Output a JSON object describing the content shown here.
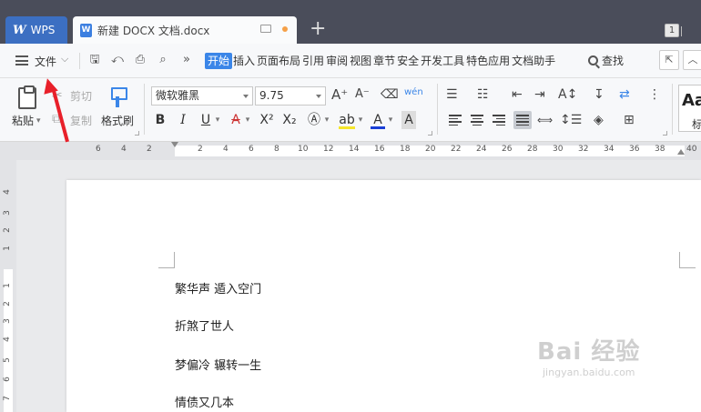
{
  "titlebar": {
    "app_tab": "WPS",
    "doc_tab": "新建 DOCX 文档.docx",
    "tab_count": "1"
  },
  "menubar": {
    "file_label": "文件",
    "tabs": [
      "开始",
      "插入",
      "页面布局",
      "引用",
      "审阅",
      "视图",
      "章节",
      "安全",
      "开发工具",
      "特色应用",
      "文档助手"
    ],
    "active_tab": "开始",
    "search_label": "查找"
  },
  "ribbon": {
    "paste_label": "粘贴",
    "cut_label": "剪切",
    "copy_label": "复制",
    "format_painter_label": "格式刷",
    "font_name": "微软雅黑",
    "font_size": "9.75",
    "style_label": "标"
  },
  "ruler": {
    "h_ticks": [
      "6",
      "4",
      "2",
      "2",
      "4",
      "6",
      "8",
      "10",
      "12",
      "14",
      "16",
      "18",
      "20",
      "22",
      "24",
      "26",
      "28",
      "30",
      "32",
      "34",
      "36",
      "38",
      "40"
    ],
    "v_ticks": [
      "4",
      "3",
      "2",
      "1",
      "1",
      "2",
      "3",
      "4",
      "5",
      "6",
      "7"
    ]
  },
  "document": {
    "lines": [
      "繁华声 遁入空门",
      "折煞了世人",
      "梦偏冷 辗转一生",
      "情债又几本"
    ]
  },
  "watermark": {
    "main": "Bai 经验",
    "sub": "jingyan.baidu.com"
  }
}
